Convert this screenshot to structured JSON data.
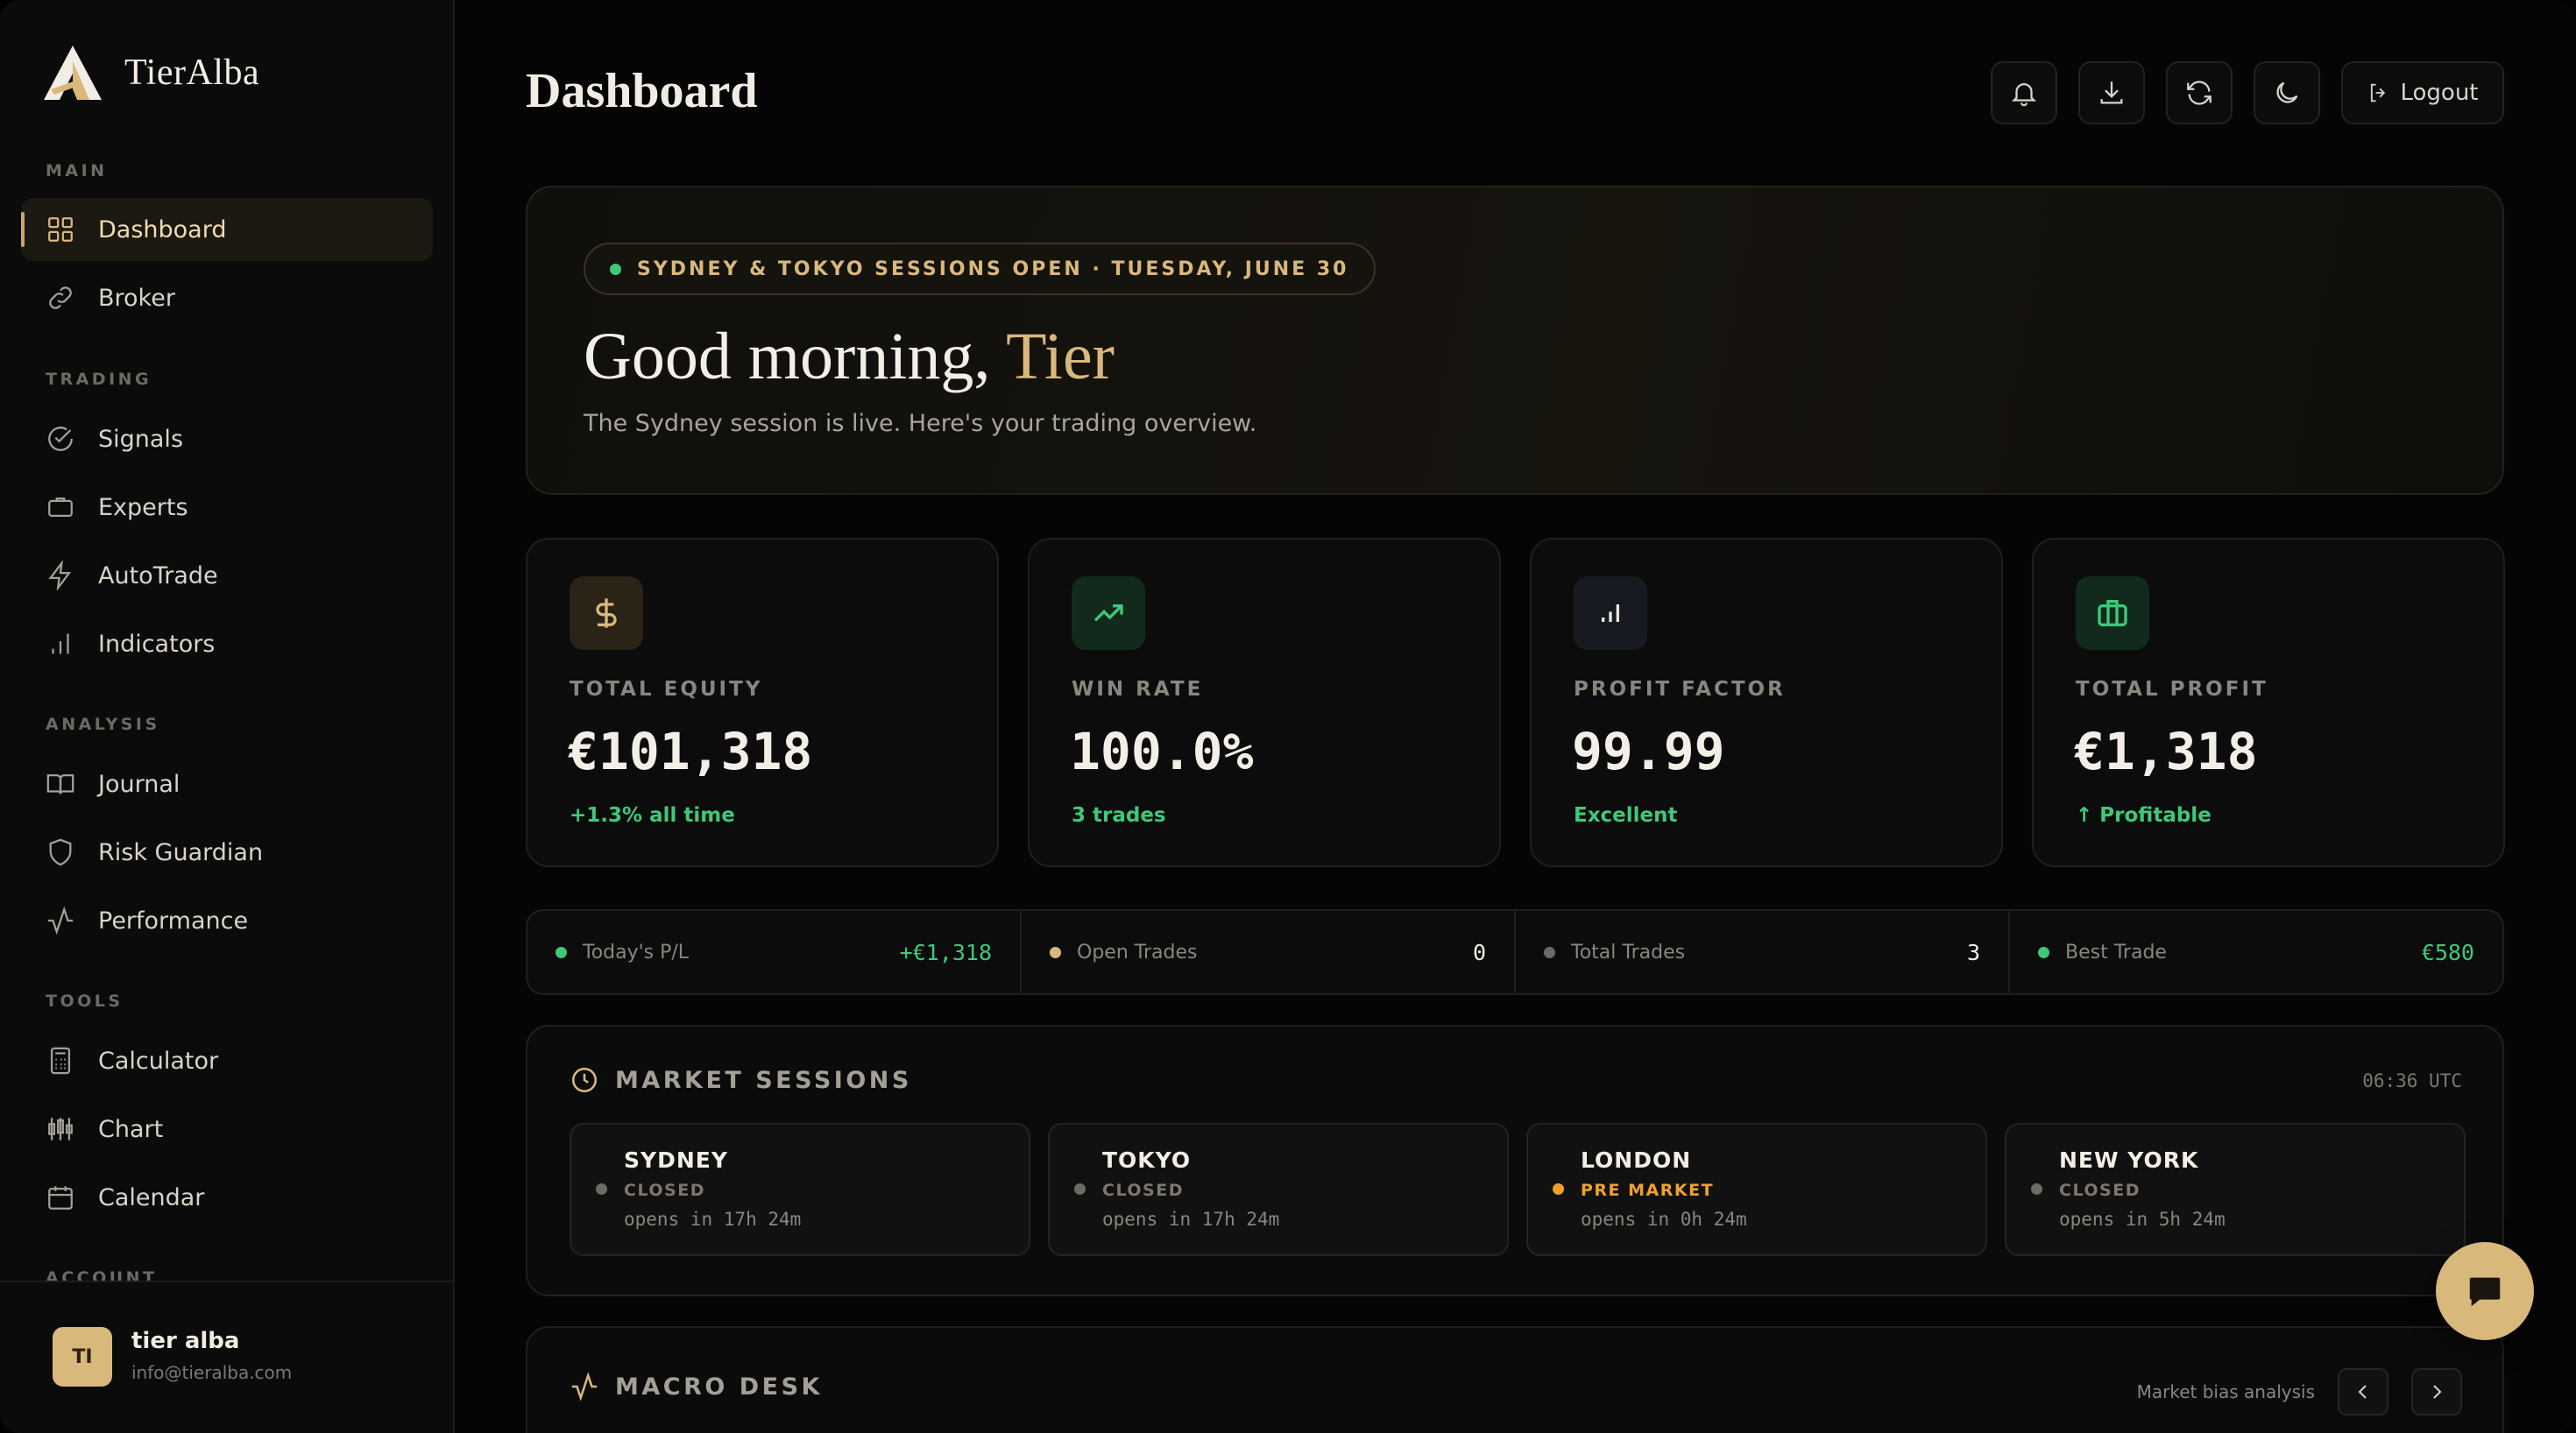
{
  "app": {
    "brand": "TierAlba",
    "page_title": "Dashboard"
  },
  "sidebar": {
    "sections": [
      {
        "label": "MAIN",
        "items": [
          {
            "label": "Dashboard",
            "icon": "grid-icon",
            "active": true
          },
          {
            "label": "Broker",
            "icon": "link-icon"
          }
        ]
      },
      {
        "label": "TRADING",
        "items": [
          {
            "label": "Signals",
            "icon": "check-circle-icon"
          },
          {
            "label": "Experts",
            "icon": "briefcase-icon"
          },
          {
            "label": "AutoTrade",
            "icon": "lightning-icon"
          },
          {
            "label": "Indicators",
            "icon": "bar-chart-icon"
          }
        ]
      },
      {
        "label": "ANALYSIS",
        "items": [
          {
            "label": "Journal",
            "icon": "book-icon"
          },
          {
            "label": "Risk Guardian",
            "icon": "shield-icon"
          },
          {
            "label": "Performance",
            "icon": "activity-icon"
          }
        ]
      },
      {
        "label": "TOOLS",
        "items": [
          {
            "label": "Calculator",
            "icon": "calculator-icon"
          },
          {
            "label": "Chart",
            "icon": "candlestick-icon"
          },
          {
            "label": "Calendar",
            "icon": "calendar-icon"
          }
        ]
      },
      {
        "label": "ACCOUNT"
      }
    ],
    "user": {
      "initials": "TI",
      "name": "tier alba",
      "email": "info@tieralba.com"
    }
  },
  "topbar": {
    "actions": [
      "bell-icon",
      "download-icon",
      "refresh-icon",
      "moon-icon"
    ],
    "logout_label": "Logout"
  },
  "hero": {
    "session_badge": "SYDNEY & TOKYO SESSIONS OPEN · TUESDAY, JUNE 30",
    "greeting_prefix": "Good morning,",
    "greeting_name": "Tier",
    "subtitle": "The Sydney session is live. Here's your trading overview."
  },
  "stats": [
    {
      "label": "TOTAL EQUITY",
      "value": "€101,318",
      "sub": "+1.3% all time",
      "icon": "dollar-icon",
      "accent": "#d9b87c",
      "icon_bg": "#2a2417"
    },
    {
      "label": "WIN RATE",
      "value": "100.0%",
      "sub": "3 trades",
      "icon": "trending-up-icon",
      "accent": "#3ec97a",
      "icon_bg": "#122a1c"
    },
    {
      "label": "PROFIT FACTOR",
      "value": "99.99",
      "sub": "Excellent",
      "icon": "bar-chart-icon",
      "accent": "#e9e6df",
      "icon_bg": "#181a22"
    },
    {
      "label": "TOTAL PROFIT",
      "value": "€1,318",
      "sub": "↑ Profitable",
      "icon": "briefcase-icon",
      "accent": "#3ec97a",
      "icon_bg": "#122a1c"
    }
  ],
  "mini_stats": [
    {
      "label": "Today's P/L",
      "value": "+€1,318",
      "dot": "#3ec97a",
      "value_color": "#3ec97a"
    },
    {
      "label": "Open Trades",
      "value": "0",
      "dot": "#d9b87c",
      "value_color": "#f3efe6"
    },
    {
      "label": "Total Trades",
      "value": "3",
      "dot": "#6d6a63",
      "value_color": "#f3efe6"
    },
    {
      "label": "Best Trade",
      "value": "€580",
      "dot": "#3ec97a",
      "value_color": "#3ec97a"
    }
  ],
  "market_sessions": {
    "title": "MARKET SESSIONS",
    "time": "06:36 UTC",
    "sessions": [
      {
        "city": "SYDNEY",
        "status": "CLOSED",
        "opens": "opens in 17h 24m",
        "status_color": "#7c7870",
        "dot": "#6d6a63"
      },
      {
        "city": "TOKYO",
        "status": "CLOSED",
        "opens": "opens in 17h 24m",
        "status_color": "#7c7870",
        "dot": "#6d6a63"
      },
      {
        "city": "LONDON",
        "status": "PRE MARKET",
        "opens": "opens in 0h 24m",
        "status_color": "#f0a030",
        "dot": "#f0a030"
      },
      {
        "city": "NEW YORK",
        "status": "CLOSED",
        "opens": "opens in 5h 24m",
        "status_color": "#7c7870",
        "dot": "#6d6a63"
      }
    ]
  },
  "macro_desk": {
    "title": "MACRO DESK",
    "hint": "Market bias analysis"
  }
}
